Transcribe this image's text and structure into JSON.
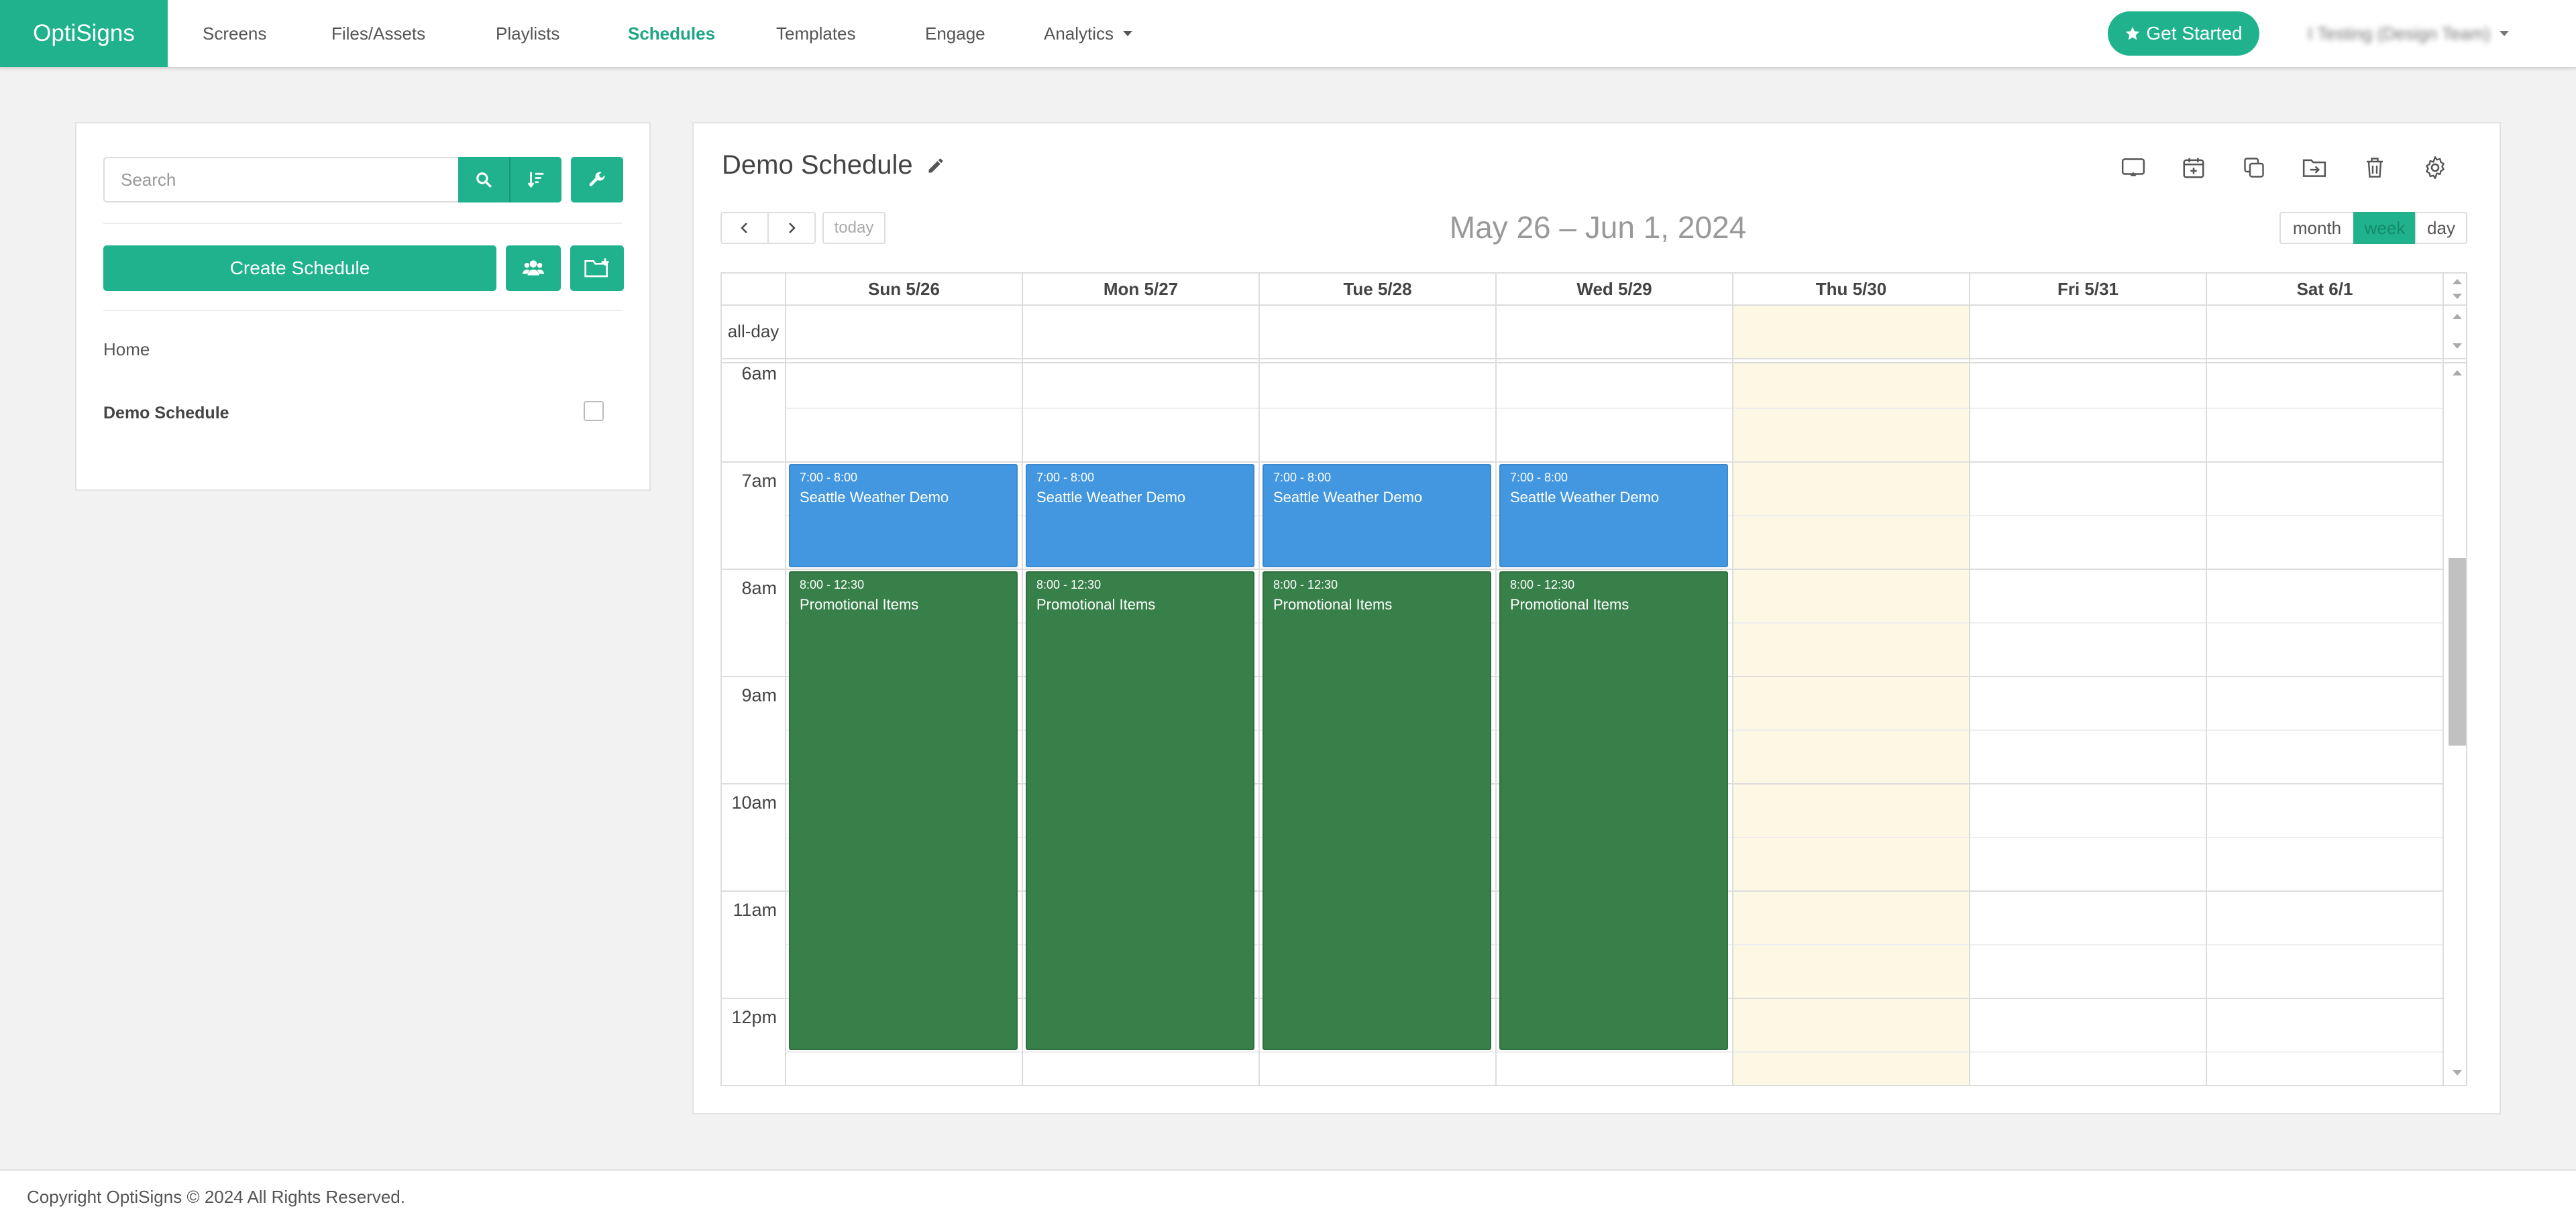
{
  "app": {
    "brand": "OptiSigns"
  },
  "nav": {
    "items": [
      {
        "label": "Screens"
      },
      {
        "label": "Files/Assets"
      },
      {
        "label": "Playlists"
      },
      {
        "label": "Schedules",
        "active": true
      },
      {
        "label": "Templates"
      },
      {
        "label": "Engage"
      },
      {
        "label": "Analytics",
        "dropdown": true
      }
    ],
    "get_started_label": "Get Started",
    "user_label": "I Testing (Design Team)"
  },
  "sidebar": {
    "search_placeholder": "Search",
    "create_label": "Create Schedule",
    "home_label": "Home",
    "schedules": [
      {
        "name": "Demo Schedule",
        "checked": false
      }
    ],
    "icons": [
      "search-icon",
      "sort-icon",
      "wrench-icon",
      "users-icon",
      "new-folder-icon"
    ]
  },
  "schedule": {
    "title": "Demo Schedule",
    "toolbar_icons": [
      "cast-icon",
      "add-calendar-icon",
      "copy-icon",
      "move-folder-icon",
      "trash-icon",
      "gear-icon"
    ],
    "range_title": "May 26 – Jun 1, 2024",
    "today_label": "today",
    "views": [
      {
        "label": "month"
      },
      {
        "label": "week",
        "active": true
      },
      {
        "label": "day"
      }
    ],
    "allday_label": "all-day",
    "days": [
      {
        "label": "Sun 5/26"
      },
      {
        "label": "Mon 5/27"
      },
      {
        "label": "Tue 5/28"
      },
      {
        "label": "Wed 5/29"
      },
      {
        "label": "Thu 5/30",
        "today": true
      },
      {
        "label": "Fri 5/31"
      },
      {
        "label": "Sat 6/1"
      }
    ],
    "hours": [
      "6am",
      "7am",
      "8am",
      "9am",
      "10am",
      "11am",
      "12pm"
    ],
    "events": [
      {
        "day": 0,
        "time": "7:00 - 8:00",
        "title": "Seattle Weather Demo",
        "color": "#4297e0"
      },
      {
        "day": 1,
        "time": "7:00 - 8:00",
        "title": "Seattle Weather Demo",
        "color": "#4297e0"
      },
      {
        "day": 2,
        "time": "7:00 - 8:00",
        "title": "Seattle Weather Demo",
        "color": "#4297e0"
      },
      {
        "day": 3,
        "time": "7:00 - 8:00",
        "title": "Seattle Weather Demo",
        "color": "#4297e0"
      },
      {
        "day": 0,
        "time": "8:00 - 12:30",
        "title": "Promotional Items",
        "color": "#378049"
      },
      {
        "day": 1,
        "time": "8:00 - 12:30",
        "title": "Promotional Items",
        "color": "#378049"
      },
      {
        "day": 2,
        "time": "8:00 - 12:30",
        "title": "Promotional Items",
        "color": "#378049"
      },
      {
        "day": 3,
        "time": "8:00 - 12:30",
        "title": "Promotional Items",
        "color": "#378049"
      }
    ]
  },
  "footer": {
    "copyright": "Copyright OptiSigns © 2024 All Rights Reserved."
  },
  "colors": {
    "accent": "#1fb28d",
    "event_blue": "#4297e0",
    "event_green": "#378049",
    "today_highlight": "#fcf8e3"
  }
}
